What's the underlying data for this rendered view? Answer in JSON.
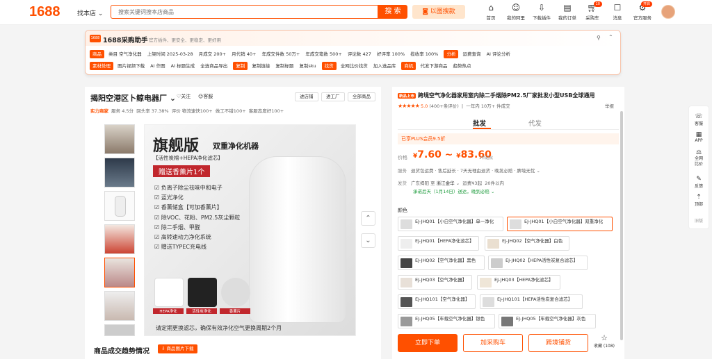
{
  "header": {
    "logo": "1688",
    "find_shop": "找本店",
    "search_placeholder": "搜索关键词搜本店商品",
    "search_button": "搜 索",
    "image_search": "以图搜款",
    "nav": [
      {
        "label": "首页",
        "icon": "home-icon"
      },
      {
        "label": "我的阿里",
        "icon": "smile-icon"
      },
      {
        "label": "下载插件",
        "icon": "download-icon"
      },
      {
        "label": "我的订单",
        "icon": "order-icon"
      },
      {
        "label": "采购车",
        "icon": "cart-icon",
        "badge": "10"
      },
      {
        "label": "消息",
        "icon": "message-icon"
      },
      {
        "label": "官方服务",
        "icon": "service-icon",
        "badge": "开启"
      }
    ]
  },
  "helper": {
    "title": "1688采购助手",
    "slogan": "官方插件、更安全、更稳定、更好用",
    "row1": {
      "tag": "商品",
      "items": [
        "类目 空气净化器",
        "上架时间 2025-03-28",
        "月成交 200+",
        "月代销 40+",
        "年成交件数 50万+",
        "年成交笔数 500+",
        "评论数 427",
        "好评率 100%",
        "揽收率 100%"
      ],
      "tag2": "分析",
      "items2": [
        "运费查询",
        "AI 评论分析"
      ]
    },
    "row2": {
      "tag": "素材处理",
      "items": [
        "图片视频下载",
        "AI 作图",
        "AI 标题生成",
        "全选商品导出"
      ],
      "tag2": "复制",
      "items2": [
        "复制链接",
        "复制标题",
        "复制sku"
      ],
      "tag3": "找货",
      "items3": [
        "全网比价找货",
        "加入选品库"
      ],
      "tag4": "商机",
      "items4": [
        "代发下游商品",
        "趋势热点"
      ]
    }
  },
  "shop": {
    "name": "揭阳空港区卜鲸电器厂",
    "follow": "关注",
    "service": "客服",
    "buttons": [
      "进店铺",
      "进工厂",
      "全部商品"
    ],
    "badge": "实力商家",
    "meta": [
      "服务",
      "4.5分",
      "回头率",
      "37.38%",
      "评价",
      "物流速快100+",
      "做工不错100+",
      "客服态度好100+"
    ]
  },
  "gallery": {
    "thumb_count": 7,
    "selected_thumb": 5,
    "main_title": "旗舰版",
    "main_subtitle": "双重净化机器",
    "filter_line": "【活性炭棉+HEPA净化滤芯】",
    "gift": "赠送香薰片1个",
    "features": [
      "负离子除尘祛味中和电子",
      "蓝光净化",
      "香薰储盒【可加香薰片】",
      "除VOC、花粉、PM2.5灰尘颗粒",
      "除二手烟、甲醛",
      "高转速动力净化系统",
      "赠送TYPEC充电线"
    ],
    "filters": [
      "HEPA净化",
      "活性炭净化",
      "香薰片"
    ],
    "bottom_note": "请定期更换滤芯，确保有效净化空气更换周期2个月",
    "arrow_up": "⌃",
    "arrow_down": "⌄"
  },
  "product": {
    "new_tag": "新品上市",
    "title": "跨境空气净化器家用室内除二手烟除PM2.5厂家批发小型USB全球通用",
    "rating": "5.0",
    "reviews": "(400+条评价)",
    "sales": "一年内 10万+ 件成交",
    "report": "举报",
    "tabs": [
      "批发",
      "代发"
    ],
    "plus": "已享PLUS会员9.5折",
    "price_label": "价格",
    "price_low": "7.60",
    "price_high": "83.60",
    "moq": "1件起批",
    "services_label": "服务",
    "services": "退货包运费 · 售后延长 · 7天无理由退货 · 晚发必赔 · 脾境无忧",
    "ship_label": "发货",
    "ship_from": "广东揭阳",
    "ship_to": "浙江金华",
    "freight": "运费¥3起",
    "stock": "20件以内",
    "promise": "承诺后天（1月14日）送达，晚到必赔",
    "color_label": "颜色",
    "options": [
      "EJ-JHQ01【小白空气净化器】单一净化",
      "EJ-JHQ01【小白空气净化器】双重净化",
      "EJ-JHQ01【HEPA净化滤芯】",
      "EJ-JHQ02【空气净化器】白色",
      "EJ-JHQ02【空气净化器】黑色",
      "EJ-JHQ02【HEPA活性炭复合滤芯】",
      "EJ-JHQ03【空气净化器】",
      "EJ-JHQ03【HEPA净化滤芯】",
      "EJ-JHQ101【空气净化器】",
      "EJ-JHQ101【HEPA活性炭复合滤芯】",
      "EJ-JHQ05【车载空气净化器】银色",
      "EJ-JHQ05【车载空气净化器】灰色"
    ],
    "buy_now": "立即下单",
    "add_cart": "加采购车",
    "cross_border": "跨境铺货",
    "favorites": "收藏 (108)"
  },
  "trend": {
    "title": "商品成交趋势情况",
    "download": "商品图片下载"
  },
  "sidebar": [
    "客服",
    "APP",
    "全网比价",
    "反馈",
    "顶部",
    "旧版"
  ],
  "colors": {
    "accent": "#ff5000"
  }
}
